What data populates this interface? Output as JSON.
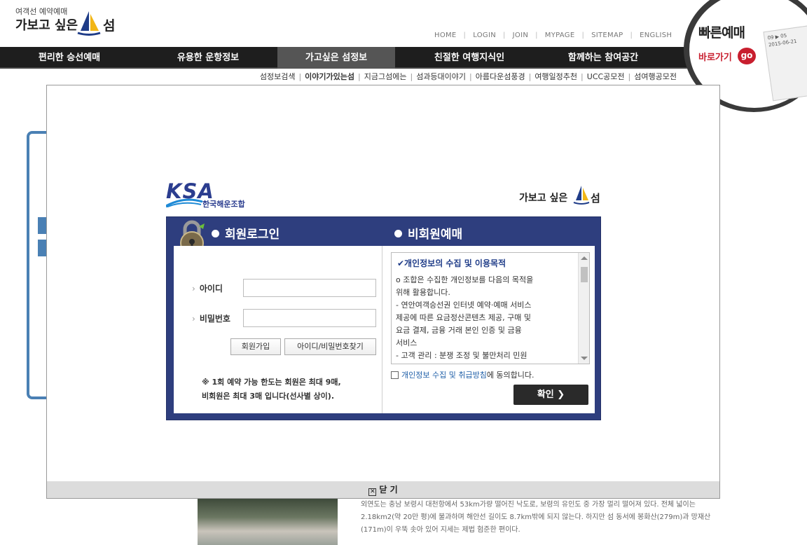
{
  "header": {
    "brand_sub": "여객선 예약예매",
    "brand_main": "가보고 싶은",
    "brand_island": "섬",
    "top_links": [
      "HOME",
      "LOGIN",
      "JOIN",
      "MYPAGE",
      "SITEMAP",
      "ENGLISH"
    ],
    "gnb": [
      "편리한 승선예매",
      "유용한 운항정보",
      "가고싶은 섬정보",
      "친절한 여행지식인",
      "함께하는 참여공간"
    ],
    "gnb_active_index": 2,
    "snb": [
      "섬정보검색",
      "이야기가있는섬",
      "지금그섬에는",
      "섬과등대이야기",
      "아름다운섬풍경",
      "여행일정추천",
      "UCC공모전",
      "섬여행공모전"
    ],
    "snb_active_index": 1,
    "quick": {
      "title": "빠른예매",
      "sub": "바로가기",
      "go": "go",
      "ticket_text": "09 ▶ 05\n2015-06-21"
    }
  },
  "background": {
    "text": "외연도는 충남 보령시 대천항에서 53km가량 떨어진 낙도로, 보령의 유인도 중 가장 멀리 떨어져 있다. 전체 넓이는 2.18km2(약 20만 평)에 불과하며 해안선 길이도 8.7km밖에 되지 않는다. 하지만 섬 동서에 봉화산(279m)과 망재산(171m)이 우뚝 솟아 있어 지세는 제법 험준한 편이다."
  },
  "modal": {
    "ksa_logo": "KSA",
    "ksa_name": "한국해운조합",
    "brand_main": "가보고 싶은",
    "brand_island": "섬",
    "member_login_title": "회원로그인",
    "nonmember_title": "비회원예매",
    "id_label": "아이디",
    "pw_label": "비밀번호",
    "id_value": "",
    "pw_value": "",
    "join_button": "회원가입",
    "find_button": "아이디/비밀번호찾기",
    "limit_note": "※ 1회 예약 가능 한도는 회원은 최대 9매,\n비회원은 최대 3매 입니다(선사별 상이).",
    "privacy_title": "✔개인정보의 수집 및 이용목적",
    "privacy_text": "o 조합은 수집한 개인정보를 다음의 목적을\n위해 활용합니다.\n- 연안여객승선권 인터넷 예약·예매 서비스\n제공에 따른 요금정산콘텐츠 제공, 구매 및\n요금 결제, 금융 거래 본인 인증 및 금융\n서비스\n- 고객 관리 : 분쟁 조정 및 불만처리 민원",
    "agree_link": "개인정보 수집 및 취급방침",
    "agree_suffix": "에 동의합니다.",
    "confirm_button": "확인  ❯",
    "close_label": "닫 기",
    "close_glyph": "✕"
  }
}
